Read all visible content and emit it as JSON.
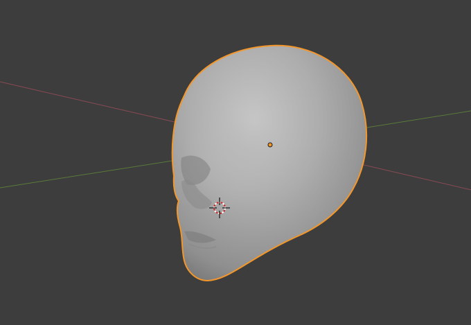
{
  "viewport": {
    "background_color": "#3d3d3d",
    "x_axis_color": "#8a4a55",
    "y_axis_color": "#5b7a3a",
    "selection_outline_color": "#f3972b",
    "mesh_color": "#a6a6a6",
    "object": {
      "semantic": "head-mesh",
      "selected": true,
      "origin_color": "#f3972b"
    },
    "cursor_3d": {
      "icon": "3d-cursor-icon",
      "ring_colors": [
        "#cc2b2b",
        "#ffffff"
      ]
    }
  }
}
